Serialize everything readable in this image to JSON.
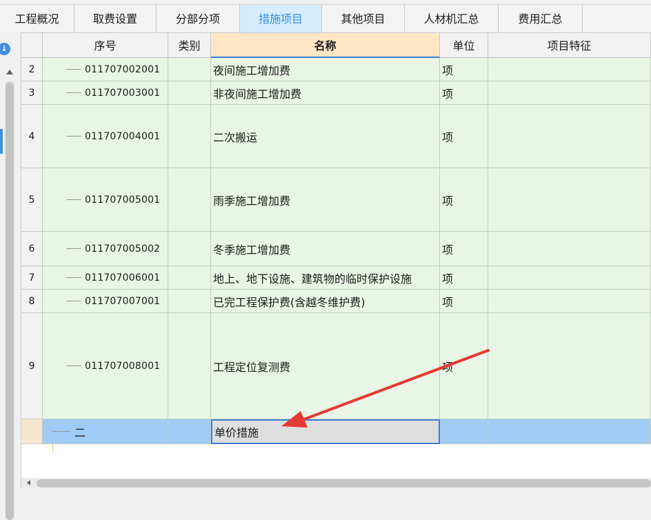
{
  "tabs": [
    {
      "label": "工程概况"
    },
    {
      "label": "取费设置"
    },
    {
      "label": "分部分项"
    },
    {
      "label": "措施项目"
    },
    {
      "label": "其他项目"
    },
    {
      "label": "人材机汇总"
    },
    {
      "label": "费用汇总"
    }
  ],
  "active_tab": "措施项目",
  "columns": {
    "seq": "序号",
    "type": "类别",
    "name": "名称",
    "unit": "单位",
    "feature": "项目特征"
  },
  "rows": [
    {
      "index": "2",
      "code": "011707002001",
      "type": "",
      "name": "夜间施工增加费",
      "unit": "项",
      "feature": ""
    },
    {
      "index": "3",
      "code": "011707003001",
      "type": "",
      "name": "非夜间施工增加费",
      "unit": "项",
      "feature": ""
    },
    {
      "index": "4",
      "code": "011707004001",
      "type": "",
      "name": "二次搬运",
      "unit": "项",
      "feature": ""
    },
    {
      "index": "5",
      "code": "011707005001",
      "type": "",
      "name": "雨季施工增加费",
      "unit": "项",
      "feature": ""
    },
    {
      "index": "6",
      "code": "011707005002",
      "type": "",
      "name": "冬季施工增加费",
      "unit": "项",
      "feature": ""
    },
    {
      "index": "7",
      "code": "011707006001",
      "type": "",
      "name": "地上、地下设施、建筑物的临时保护设施",
      "unit": "项",
      "feature": ""
    },
    {
      "index": "8",
      "code": "011707007001",
      "type": "",
      "name": "已完工程保护费(含越冬维护费)",
      "unit": "项",
      "feature": ""
    },
    {
      "index": "9",
      "code": "011707008001",
      "type": "",
      "name": "工程定位复测费",
      "unit": "项",
      "feature": ""
    }
  ],
  "selected_row": {
    "index": "",
    "code": "二",
    "type": "",
    "name": "单价措施",
    "unit": "",
    "feature": ""
  },
  "icons": {
    "side_action": "download-icon",
    "scroll_up": "triangle-up-icon",
    "scroll_left": "triangle-left-icon"
  },
  "colors": {
    "accent": "#3a8ee6",
    "row_bg": "#eaf6e5",
    "selected_bg": "#9fcbf4",
    "annotation": "#e53935"
  }
}
